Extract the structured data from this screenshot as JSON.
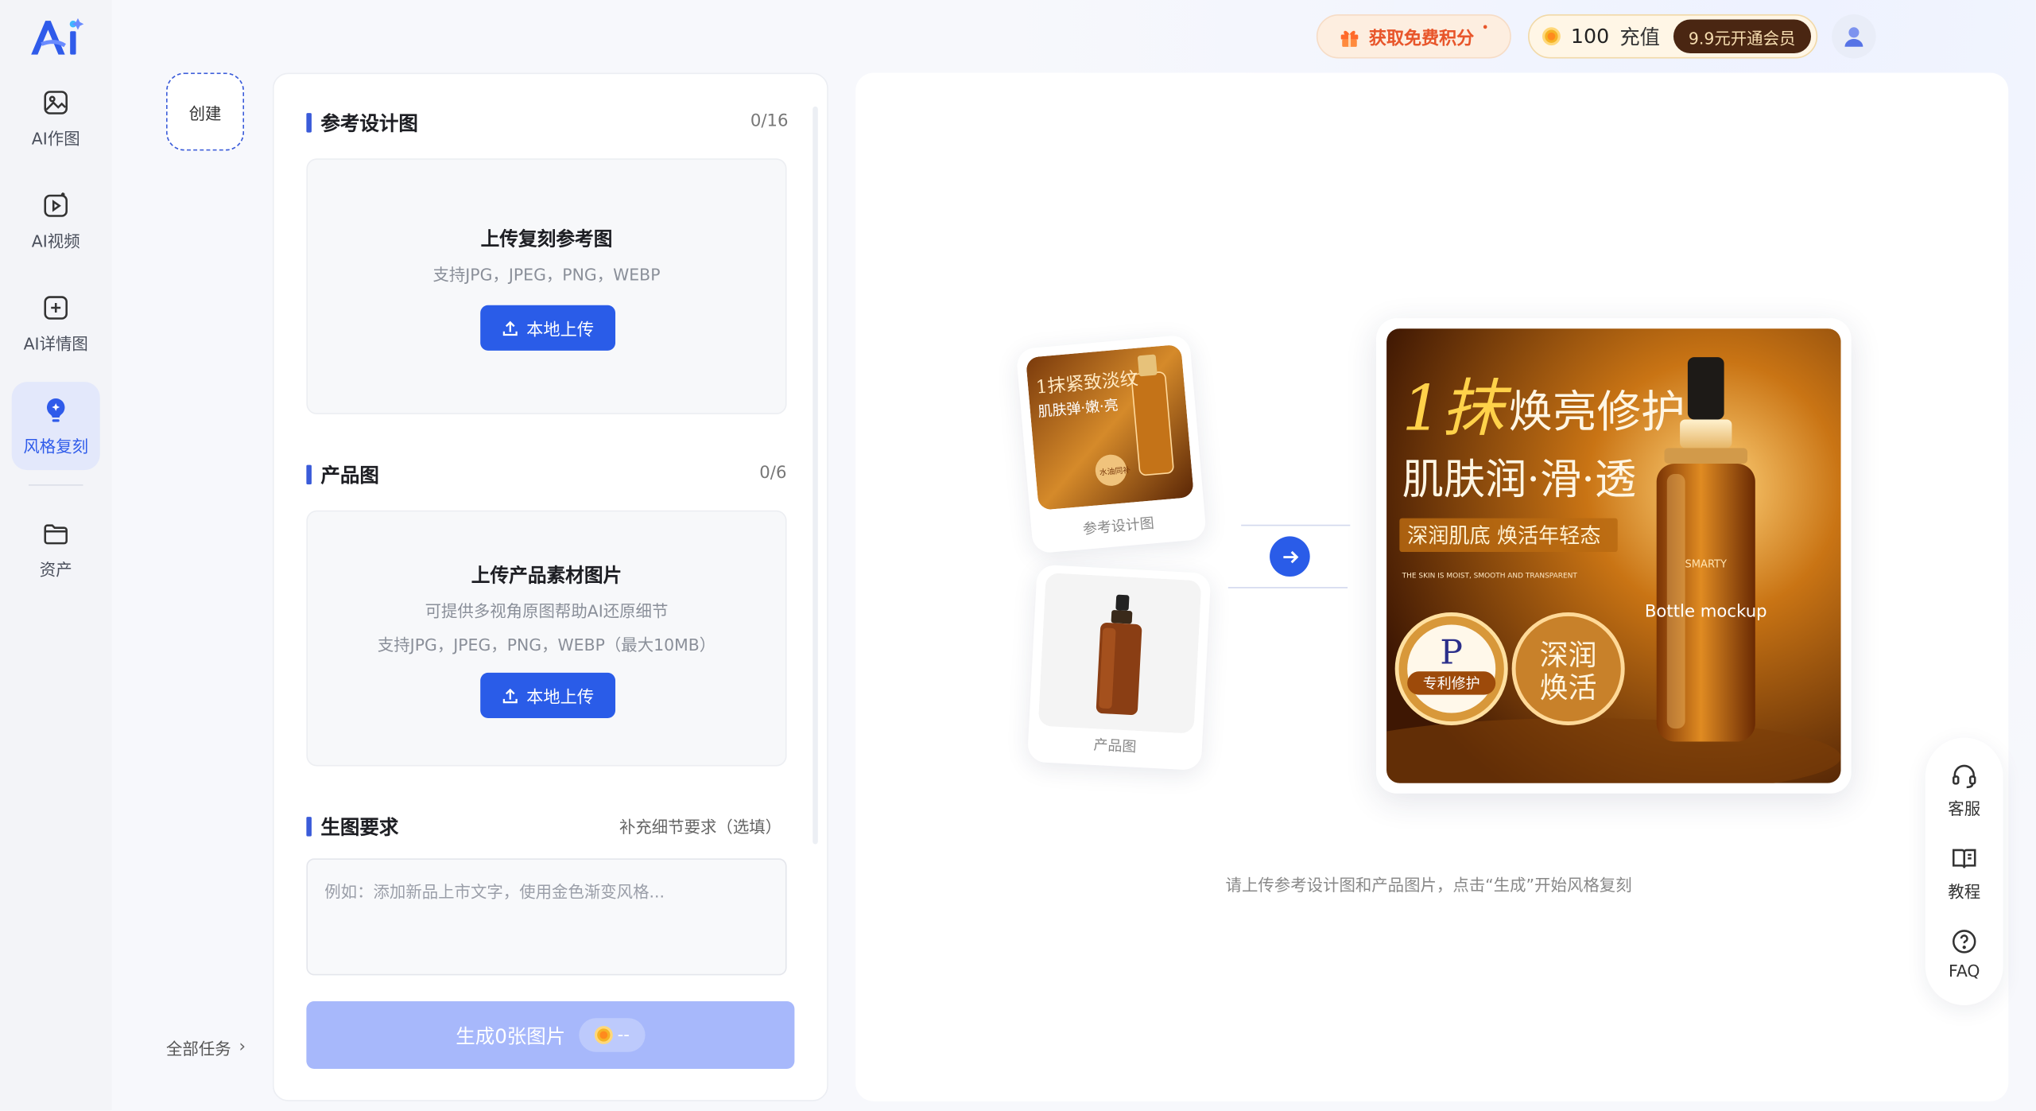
{
  "sidebar": {
    "items": [
      {
        "label": "AI作图",
        "icon": "image-icon"
      },
      {
        "label": "AI视频",
        "icon": "video-icon"
      },
      {
        "label": "AI详情图",
        "icon": "plus-square-icon"
      },
      {
        "label": "风格复刻",
        "icon": "bulb-icon",
        "active": true
      },
      {
        "label": "资产",
        "icon": "folder-icon"
      }
    ]
  },
  "create": {
    "label": "创建"
  },
  "all_tasks": {
    "label": "全部任务"
  },
  "form": {
    "reference": {
      "title": "参考设计图",
      "count": "0/16",
      "upload_title": "上传复刻参考图",
      "upload_sub": "支持JPG，JPEG，PNG，WEBP",
      "button": "本地上传"
    },
    "product": {
      "title": "产品图",
      "count": "0/6",
      "upload_title": "上传产品素材图片",
      "upload_sub1": "可提供多视角原图帮助AI还原细节",
      "upload_sub2": "支持JPG，JPEG，PNG，WEBP（最大10MB）",
      "button": "本地上传"
    },
    "requirements": {
      "title": "生图要求",
      "hint": "补充细节要求（选填）",
      "placeholder": "例如：添加新品上市文字，使用金色渐变风格..."
    },
    "generate": {
      "label": "生成0张图片",
      "cost": "--"
    }
  },
  "preview": {
    "ref_caption": "参考设计图",
    "product_caption": "产品图",
    "small_ad": {
      "line1": "1抹紧致淡纹",
      "line2": "肌肤弹·嫩·亮",
      "badge": "水油同补"
    },
    "big_ad": {
      "headline_1": "1抹",
      "headline_2": "焕亮修护",
      "line2": "肌肤润·滑·透",
      "ribbon": "深润肌底 焕活年轻态",
      "sub": "THE SKIN IS MOIST, SMOOTH AND TRANSPARENT",
      "badge_left": "专利修护",
      "badge_right_1": "深润",
      "badge_right_2": "焕活",
      "bottle_brand": "SMARTY",
      "bottle_label": "Bottle mockup"
    },
    "hint": "请上传参考设计图和产品图片，点击“生成”开始风格复刻"
  },
  "header": {
    "promo": "获取免费积分",
    "credits": "100",
    "recharge": "充值",
    "vip": "9.9元开通会员"
  },
  "float_tools": [
    {
      "label": "客服",
      "icon": "headset-icon"
    },
    {
      "label": "教程",
      "icon": "book-icon"
    },
    {
      "label": "FAQ",
      "icon": "question-icon"
    }
  ],
  "colors": {
    "accent": "#2a5ce8",
    "active_bg": "#e3e8fb",
    "vip_bg": "#4a2612",
    "promo": "#e8562b"
  }
}
